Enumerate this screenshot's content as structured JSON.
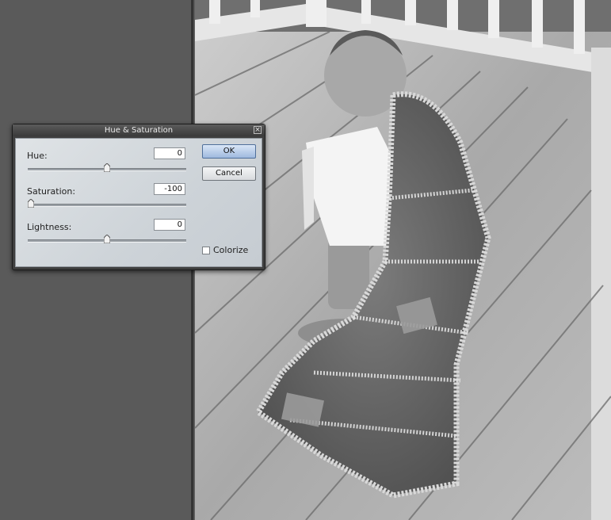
{
  "dialog": {
    "title": "Hue & Saturation",
    "close_glyph": "×",
    "hue": {
      "label": "Hue:",
      "value": "0",
      "slider_fraction": 0.5
    },
    "saturation": {
      "label": "Saturation:",
      "value": "-100",
      "slider_fraction": 0.0
    },
    "lightness": {
      "label": "Lightness:",
      "value": "0",
      "slider_fraction": 0.5
    },
    "ok_label": "OK",
    "cancel_label": "Cancel",
    "colorize_label": "Colorize",
    "colorize_checked": false
  },
  "colors": {
    "workspace": "#5a5a5a",
    "dialog_body": "#d3d8dc",
    "ok_button": "#a9c1e2"
  }
}
